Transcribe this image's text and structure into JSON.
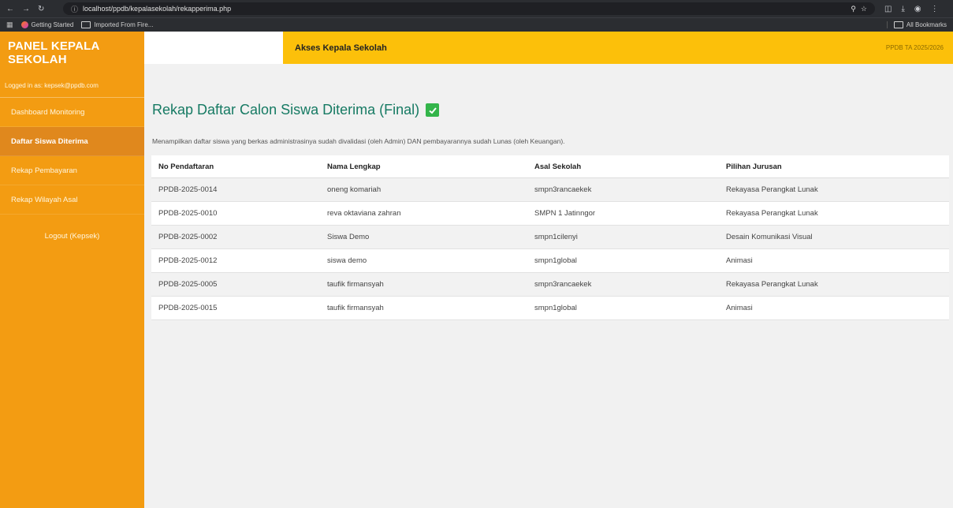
{
  "browser": {
    "url": "localhost/ppdb/kepalasekolah/rekapperima.php",
    "bookmarks": [
      {
        "label": "Getting Started"
      },
      {
        "label": "Imported From Fire..."
      }
    ],
    "all_bookmarks": "All Bookmarks"
  },
  "sidebar": {
    "title": "PANEL KEPALA SEKOLAH",
    "logged_in": "Logged in as: kepsek@ppdb.com",
    "items": [
      {
        "label": "Dashboard Monitoring"
      },
      {
        "label": "Daftar Siswa Diterima"
      },
      {
        "label": "Rekap Pembayaran"
      },
      {
        "label": "Rekap Wilayah Asal"
      }
    ],
    "logout": "Logout (Kepsek)"
  },
  "header": {
    "akses": "Akses Kepala Sekolah",
    "tahun_ajaran": "PPDB TA 2025/2026"
  },
  "main": {
    "title": "Rekap Daftar Calon Siswa Diterima (Final)",
    "description": "Menampilkan daftar siswa yang berkas administrasinya sudah divalidasi (oleh Admin) DAN pembayarannya sudah Lunas (oleh Keuangan).",
    "columns": [
      "No Pendaftaran",
      "Nama Lengkap",
      "Asal Sekolah",
      "Pilihan Jurusan"
    ],
    "rows": [
      [
        "PPDB-2025-0014",
        "oneng komariah",
        "smpn3rancaekek",
        "Rekayasa Perangkat Lunak"
      ],
      [
        "PPDB-2025-0010",
        "reva oktaviana zahran",
        "SMPN 1 Jatinngor",
        "Rekayasa Perangkat Lunak"
      ],
      [
        "PPDB-2025-0002",
        "Siswa Demo",
        "smpn1cilenyi",
        "Desain Komunikasi Visual"
      ],
      [
        "PPDB-2025-0012",
        "siswa demo",
        "smpn1global",
        "Animasi"
      ],
      [
        "PPDB-2025-0005",
        "taufik firmansyah",
        "smpn3rancaekek",
        "Rekayasa Perangkat Lunak"
      ],
      [
        "PPDB-2025-0015",
        "taufik firmansyah",
        "smpn1global",
        "Animasi"
      ]
    ]
  }
}
